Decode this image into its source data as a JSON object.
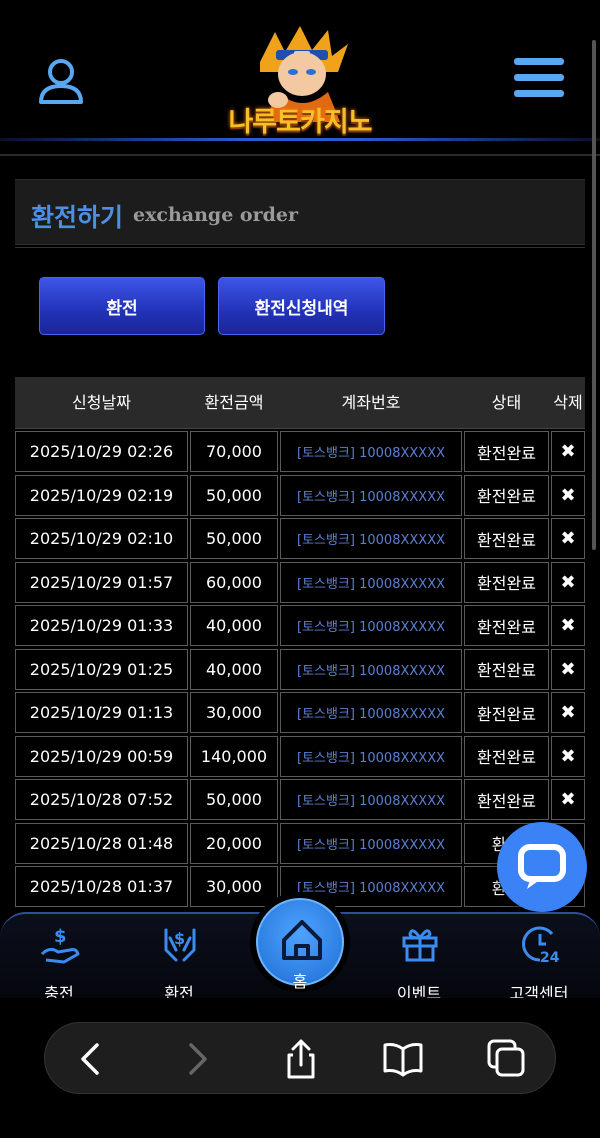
{
  "header": {
    "logo_text": "나루토카지노",
    "user_icon": "user-icon",
    "menu_icon": "hamburger-menu-icon"
  },
  "title": {
    "korean": "환전하기",
    "english": "exchange order"
  },
  "buttons": {
    "exchange": "환전",
    "history": "환전신청내역"
  },
  "table": {
    "headers": [
      "신청날짜",
      "환전금액",
      "계좌번호",
      "상태",
      "삭제"
    ],
    "rows": [
      {
        "date": "2025/10/29 02:26",
        "amount": "70,000",
        "account": "[토스뱅크] 10008XXXXX",
        "status": "환전완료",
        "delete": "✖"
      },
      {
        "date": "2025/10/29 02:19",
        "amount": "50,000",
        "account": "[토스뱅크] 10008XXXXX",
        "status": "환전완료",
        "delete": "✖"
      },
      {
        "date": "2025/10/29 02:10",
        "amount": "50,000",
        "account": "[토스뱅크] 10008XXXXX",
        "status": "환전완료",
        "delete": "✖"
      },
      {
        "date": "2025/10/29 01:57",
        "amount": "60,000",
        "account": "[토스뱅크] 10008XXXXX",
        "status": "환전완료",
        "delete": "✖"
      },
      {
        "date": "2025/10/29 01:33",
        "amount": "40,000",
        "account": "[토스뱅크] 10008XXXXX",
        "status": "환전완료",
        "delete": "✖"
      },
      {
        "date": "2025/10/29 01:25",
        "amount": "40,000",
        "account": "[토스뱅크] 10008XXXXX",
        "status": "환전완료",
        "delete": "✖"
      },
      {
        "date": "2025/10/29 01:13",
        "amount": "30,000",
        "account": "[토스뱅크] 10008XXXXX",
        "status": "환전완료",
        "delete": "✖"
      },
      {
        "date": "2025/10/29 00:59",
        "amount": "140,000",
        "account": "[토스뱅크] 10008XXXXX",
        "status": "환전완료",
        "delete": "✖"
      },
      {
        "date": "2025/10/28 07:52",
        "amount": "50,000",
        "account": "[토스뱅크] 10008XXXXX",
        "status": "환전완료",
        "delete": "✖"
      },
      {
        "date": "2025/10/28 01:48",
        "amount": "20,000",
        "account": "[토스뱅크] 10008XXXXX",
        "status": "환전",
        "delete": ""
      },
      {
        "date": "2025/10/28 01:37",
        "amount": "30,000",
        "account": "[토스뱅크] 10008XXXXX",
        "status": "환전",
        "delete": ""
      }
    ]
  },
  "chat_icon": "chat-bubble-icon",
  "bottom_nav": {
    "items": [
      {
        "label": "충전",
        "icon": "deposit-icon"
      },
      {
        "label": "환전",
        "icon": "withdraw-icon"
      },
      {
        "label": "홈",
        "icon": "home-icon"
      },
      {
        "label": "이벤트",
        "icon": "gift-icon"
      },
      {
        "label": "고객센터",
        "icon": "support-24-icon"
      }
    ]
  },
  "browser": {
    "icons": [
      "back-icon",
      "forward-icon",
      "share-icon",
      "bookmarks-icon",
      "tabs-icon"
    ]
  },
  "colors": {
    "accent": "#4e8fe6",
    "button": "#2a3ccf",
    "account_text": "#5b7fd0",
    "nav_highlight": "#3b82f6"
  }
}
